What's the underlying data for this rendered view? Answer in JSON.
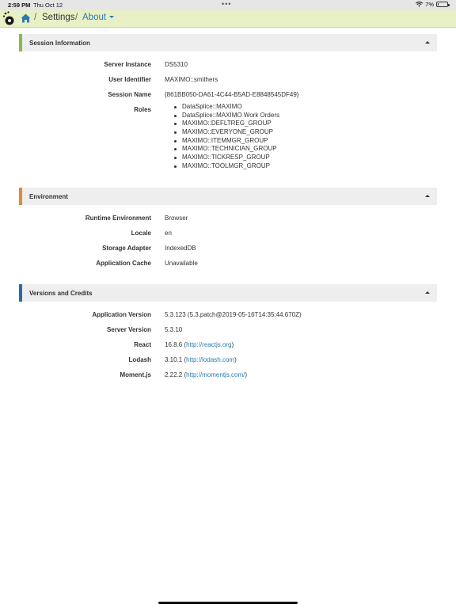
{
  "status_bar": {
    "time": "2:59 PM",
    "date": "Thu Oct 12",
    "battery": "7%",
    "battery_fraction": 0.07
  },
  "breadcrumb": {
    "separator": "/",
    "settings": "Settings",
    "about": "About"
  },
  "colors": {
    "accent_session": "#8cb84a",
    "accent_environment": "#e8882e",
    "accent_versions": "#2a6aa6",
    "link": "#2a7ab0"
  },
  "session": {
    "title": "Session Information",
    "rows": [
      {
        "label": "Server Instance",
        "value": "DS5310"
      },
      {
        "label": "User Identifier",
        "value": "MAXIMO::smithers"
      },
      {
        "label": "Session Name",
        "value": "{861BB050-DA61-4C44-B5AD-E8848545DF49}"
      }
    ],
    "roles_label": "Roles",
    "roles": [
      "DataSplice::MAXIMO",
      "DataSplice::MAXIMO Work Orders",
      "MAXIMO::DEFLTREG_GROUP",
      "MAXIMO::EVERYONE_GROUP",
      "MAXIMO::ITEMMGR_GROUP",
      "MAXIMO::TECHNICIAN_GROUP",
      "MAXIMO::TICKRESP_GROUP",
      "MAXIMO::TOOLMGR_GROUP"
    ]
  },
  "environment": {
    "title": "Environment",
    "rows": [
      {
        "label": "Runtime Environment",
        "value": "Browser"
      },
      {
        "label": "Locale",
        "value": "en"
      },
      {
        "label": "Storage Adapter",
        "value": "IndexedDB"
      },
      {
        "label": "Application Cache",
        "value": "Unavailable"
      }
    ]
  },
  "versions": {
    "title": "Versions and Credits",
    "rows": [
      {
        "label": "Application Version",
        "value": "5.3.123 (5.3.patch@2019-05-16T14:35:44.670Z)"
      },
      {
        "label": "Server Version",
        "value": "5.3.10"
      },
      {
        "label": "React",
        "version": "16.8.6",
        "link": "http://reactjs.org"
      },
      {
        "label": "Lodash",
        "version": "3.10.1",
        "link": "http://lodash.com"
      },
      {
        "label": "Moment.js",
        "version": "2.22.2",
        "link": "http://momentjs.com/"
      }
    ]
  }
}
